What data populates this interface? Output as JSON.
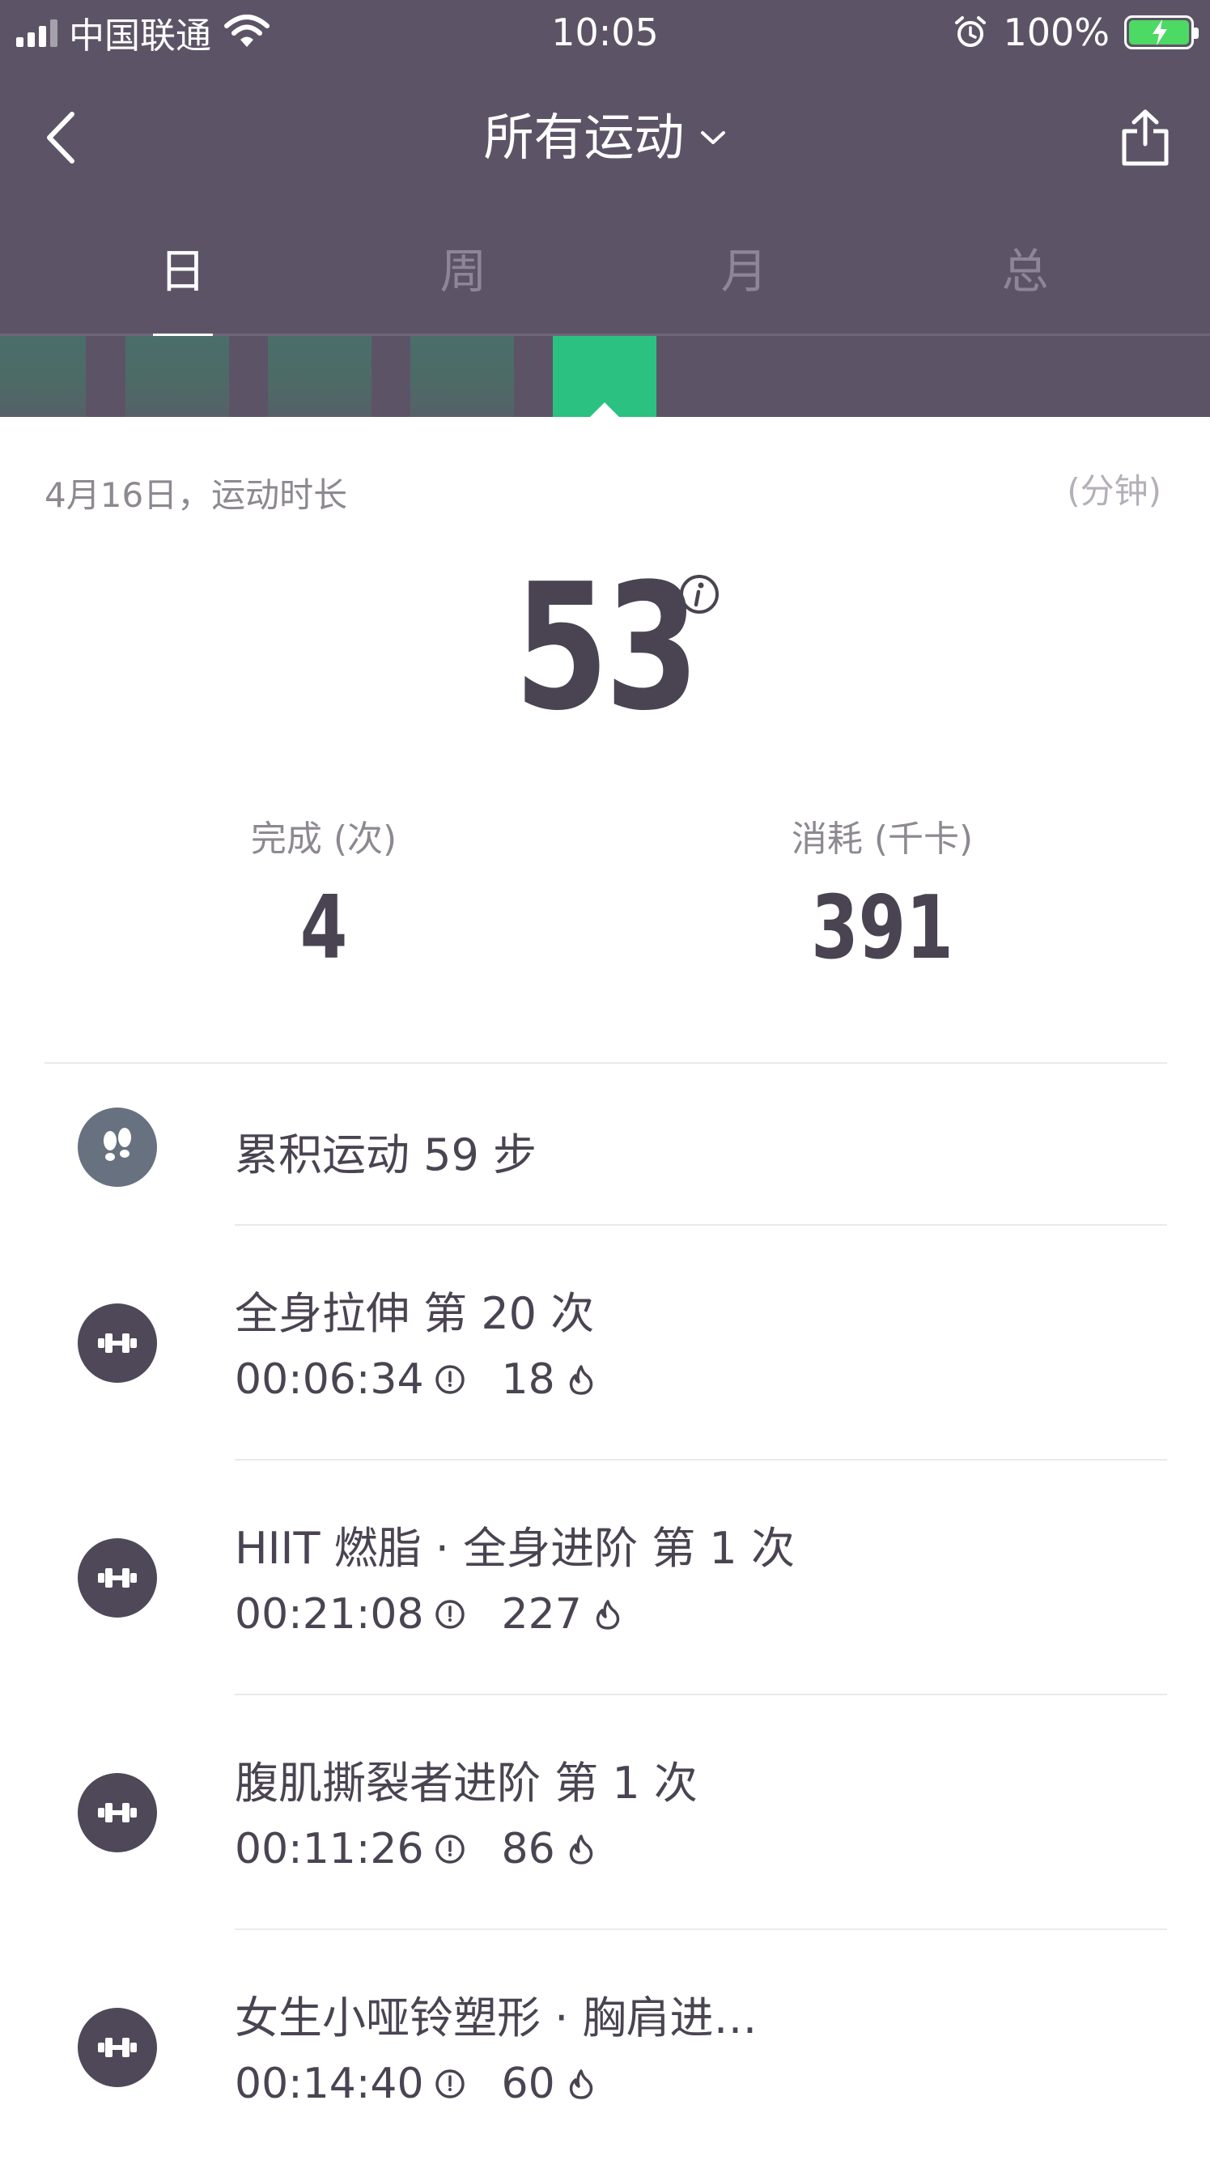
{
  "status_bar": {
    "carrier": "中国联通",
    "time": "10:05",
    "battery_percent": "100%",
    "battery_color": "#4cd964"
  },
  "nav": {
    "title": "所有运动",
    "back_icon": "chevron-left-icon",
    "dropdown_icon": "chevron-down-icon",
    "share_icon": "share-icon"
  },
  "tabs": [
    {
      "label": "日",
      "active": true
    },
    {
      "label": "周",
      "active": false
    },
    {
      "label": "月",
      "active": false
    },
    {
      "label": "总",
      "active": false
    }
  ],
  "colors": {
    "header_bg": "#5c5466",
    "accent_green": "#2bc180",
    "text_dark": "#4a4452"
  },
  "summary": {
    "date_label": "4月16日，运动时长",
    "unit_label": "(分钟)",
    "duration_minutes": "53",
    "count_label": "完成 (次)",
    "count_value": "4",
    "kcal_label": "消耗 (千卡)",
    "kcal_value": "391"
  },
  "activities": [
    {
      "icon": "footsteps-icon",
      "title": "累积运动 59 步"
    },
    {
      "icon": "dumbbell-icon",
      "title": "全身拉伸  第 20 次",
      "duration": "00:06:34",
      "kcal": "18"
    },
    {
      "icon": "dumbbell-icon",
      "title": "HIIT 燃脂 · 全身进阶  第 1 次",
      "duration": "00:21:08",
      "kcal": "227"
    },
    {
      "icon": "dumbbell-icon",
      "title": "腹肌撕裂者进阶  第 1 次",
      "duration": "00:11:26",
      "kcal": "86"
    },
    {
      "icon": "dumbbell-icon",
      "title": "女生小哑铃塑形 · 胸肩进…",
      "duration": "00:14:40",
      "kcal": "60"
    }
  ]
}
